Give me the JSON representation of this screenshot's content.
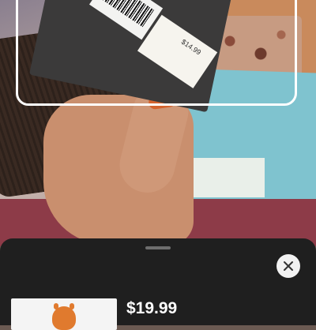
{
  "camera": {
    "product_sticker_price": "$14.99"
  },
  "result_sheet": {
    "product_price": "$19.99",
    "close_icon": "close-icon"
  },
  "colors": {
    "sheet_background": "#1f1f1f",
    "scan_frame": "#ffffff",
    "close_button": "#f2f2f2"
  }
}
